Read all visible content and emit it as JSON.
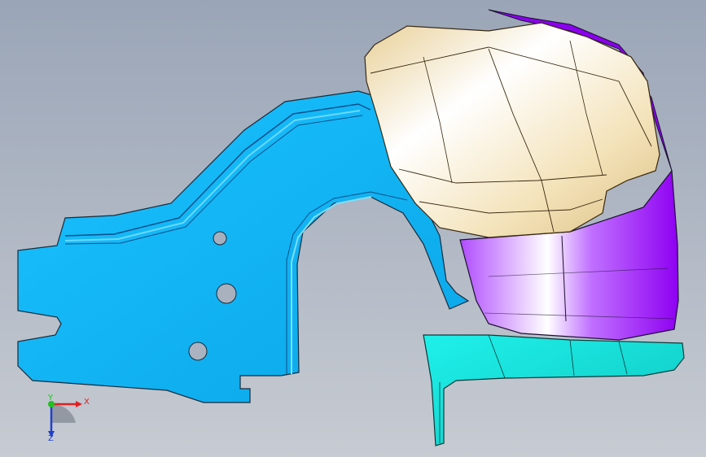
{
  "viewport": {
    "background_top": "#9aa5b7",
    "background_bottom": "#c7cbd2"
  },
  "parts": {
    "bracket_color": "#18b6f2",
    "bumper_upper_color": "#f3e0b4",
    "bumper_lower_color": "#a400ff",
    "plate_color": "#16e6e0"
  },
  "triad": {
    "x_label": "X",
    "y_label": "Y",
    "z_label": "Z",
    "x_color": "#e02020",
    "y_color": "#20c020",
    "z_color": "#2040d0"
  }
}
